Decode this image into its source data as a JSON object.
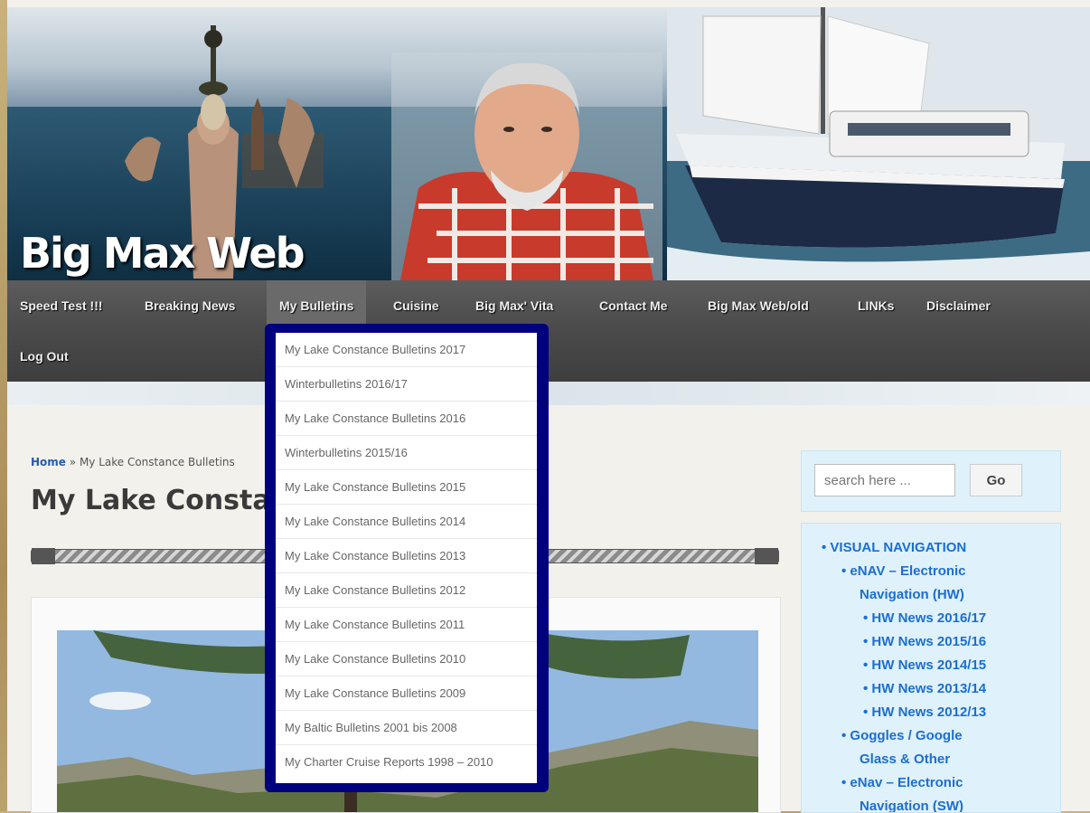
{
  "site": {
    "logo_text": "Big Max Web"
  },
  "nav": {
    "items": [
      "Speed Test !!!",
      "Breaking News",
      "My Bulletins",
      "Cuisine",
      "Big Max' Vita",
      "Contact Me",
      "Big Max Web/old",
      "LINKs",
      "Disclaimer"
    ],
    "row2": [
      "Log Out"
    ],
    "active": "My Bulletins"
  },
  "dropdown": {
    "items": [
      "My Lake Constance Bulletins 2017",
      "Winterbulletins 2016/17",
      "My Lake Constance Bulletins 2016",
      "Winterbulletins 2015/16",
      "My Lake Constance Bulletins 2015",
      "My Lake Constance Bulletins 2014",
      "My Lake Constance Bulletins 2013",
      "My Lake Constance Bulletins 2012",
      "My Lake Constance Bulletins 2011",
      "My Lake Constance Bulletins 2010",
      "My Lake Constance Bulletins 2009",
      "My Baltic Bulletins 2001 bis 2008",
      "My Charter Cruise Reports 1998 – 2010"
    ]
  },
  "breadcrumb": {
    "home": "Home",
    "sep": "»",
    "current": "My Lake Constance Bulletins"
  },
  "page": {
    "title": "My Lake Constan"
  },
  "search": {
    "placeholder": "search here ...",
    "button": "Go"
  },
  "sidebar": {
    "items": [
      {
        "label": "VISUAL NAVIGATION",
        "level": 0
      },
      {
        "label": "eNAV – Electronic",
        "level": 1
      },
      {
        "label": "Navigation (HW)",
        "level": 1,
        "cont": true
      },
      {
        "label": "HW News 2016/17",
        "level": 2
      },
      {
        "label": "HW News 2015/16",
        "level": 2
      },
      {
        "label": "HW News 2014/15",
        "level": 2
      },
      {
        "label": "HW News 2013/14",
        "level": 2
      },
      {
        "label": "HW News 2012/13",
        "level": 2
      },
      {
        "label": "Goggles / Google",
        "level": 1
      },
      {
        "label": "Glass & Other",
        "level": 1,
        "cont": true
      },
      {
        "label": "eNav – Electronic",
        "level": 1
      },
      {
        "label": "Navigation (SW)",
        "level": 1,
        "cont": true
      }
    ]
  },
  "colors": {
    "dropdown_border": "#00007e",
    "link": "#1b6ed2",
    "nav_bg": "#4a4a4a"
  }
}
